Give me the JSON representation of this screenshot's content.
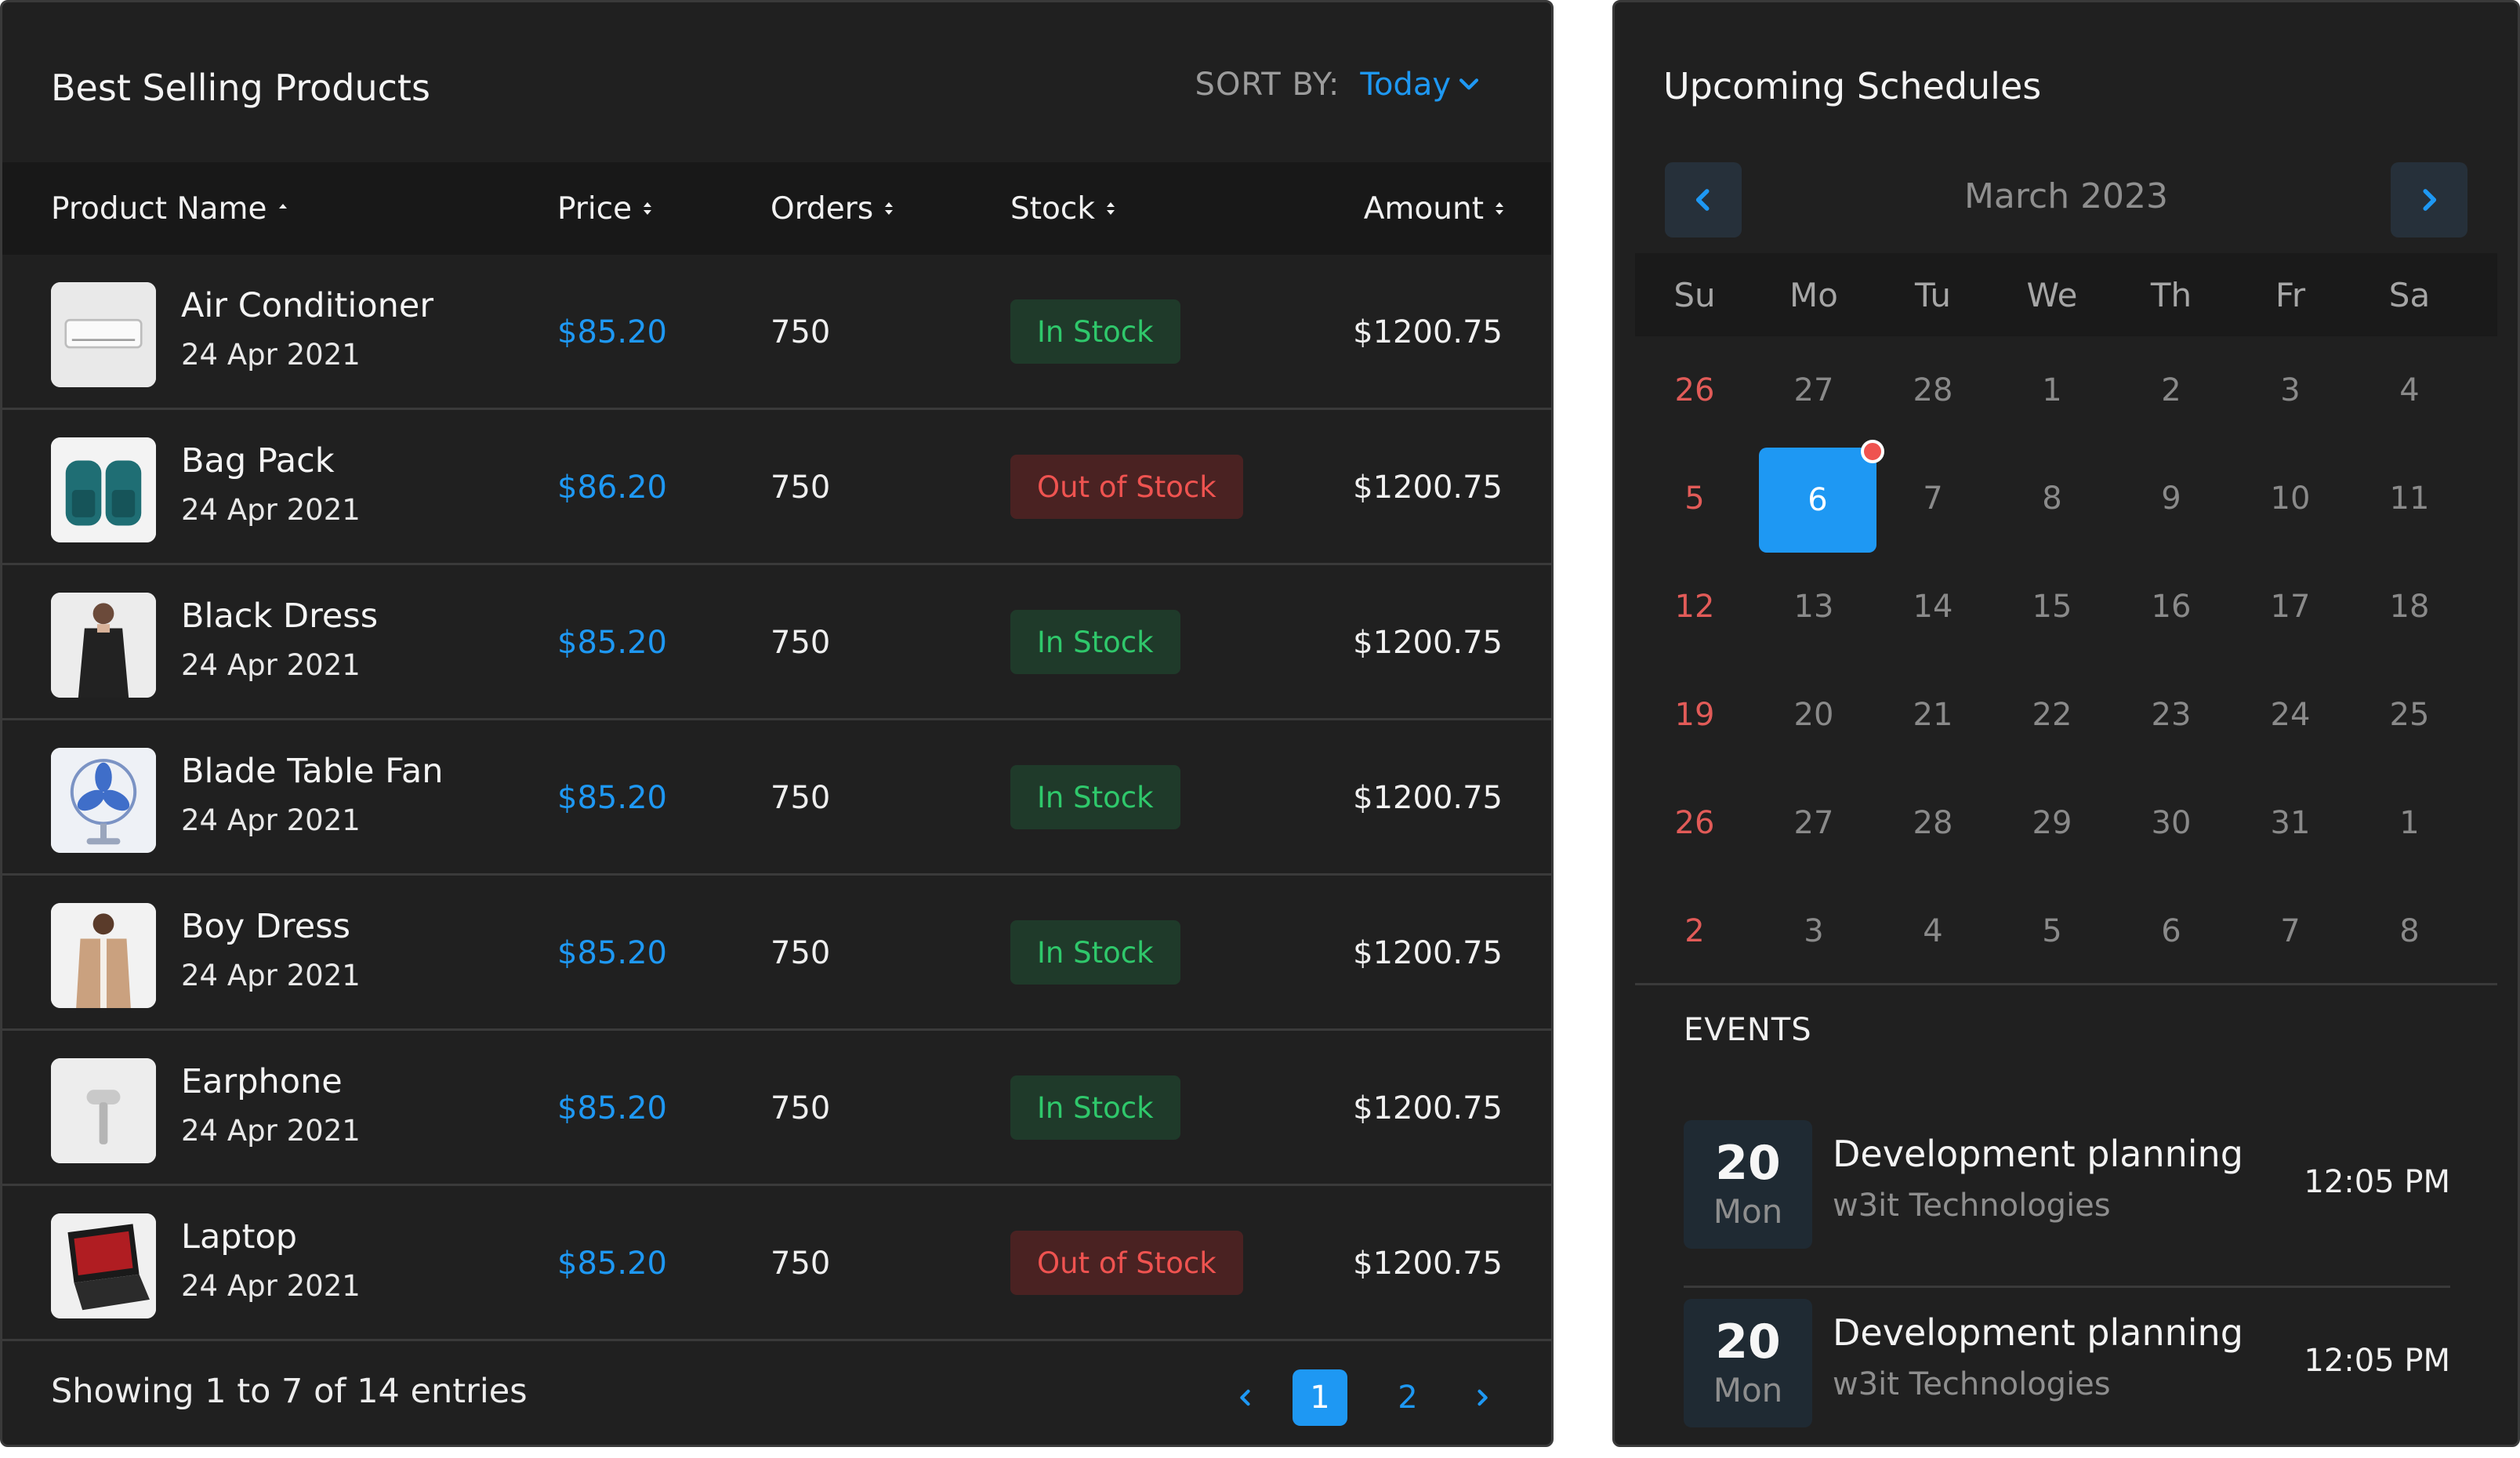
{
  "products": {
    "title": "Best Selling Products",
    "sort_label": "SORT BY:",
    "sort_value": "Today",
    "columns": {
      "name": "Product Name",
      "price": "Price",
      "orders": "Orders",
      "stock": "Stock",
      "amount": "Amount"
    },
    "rows": [
      {
        "name": "Air Conditioner",
        "date": "24 Apr 2021",
        "price": "$85.20",
        "orders": "750",
        "stock": "In Stock",
        "stock_status": "in",
        "amount": "$1200.75",
        "thumb_icon": "air-conditioner-icon"
      },
      {
        "name": "Bag Pack",
        "date": "24 Apr 2021",
        "price": "$86.20",
        "orders": "750",
        "stock": "Out of Stock",
        "stock_status": "out",
        "amount": "$1200.75",
        "thumb_icon": "backpack-icon"
      },
      {
        "name": "Black Dress",
        "date": "24 Apr 2021",
        "price": "$85.20",
        "orders": "750",
        "stock": "In Stock",
        "stock_status": "in",
        "amount": "$1200.75",
        "thumb_icon": "dress-icon"
      },
      {
        "name": "Blade Table Fan",
        "date": "24 Apr 2021",
        "price": "$85.20",
        "orders": "750",
        "stock": "In Stock",
        "stock_status": "in",
        "amount": "$1200.75",
        "thumb_icon": "fan-icon"
      },
      {
        "name": "Boy Dress",
        "date": "24 Apr 2021",
        "price": "$85.20",
        "orders": "750",
        "stock": "In Stock",
        "stock_status": "in",
        "amount": "$1200.75",
        "thumb_icon": "jacket-icon"
      },
      {
        "name": "Earphone",
        "date": "24 Apr 2021",
        "price": "$85.20",
        "orders": "750",
        "stock": "In Stock",
        "stock_status": "in",
        "amount": "$1200.75",
        "thumb_icon": "hairdryer-icon"
      },
      {
        "name": "Laptop",
        "date": "24 Apr 2021",
        "price": "$85.20",
        "orders": "750",
        "stock": "Out of Stock",
        "stock_status": "out",
        "amount": "$1200.75",
        "thumb_icon": "laptop-icon"
      }
    ],
    "footer_text": "Showing 1 to 7 of 14 entries",
    "pages": [
      "1",
      "2"
    ],
    "current_page": "1"
  },
  "schedule": {
    "title": "Upcoming Schedules",
    "month": "March 2023",
    "weekdays": [
      "Su",
      "Mo",
      "Tu",
      "We",
      "Th",
      "Fr",
      "Sa"
    ],
    "weeks": [
      [
        "26",
        "27",
        "28",
        "1",
        "2",
        "3",
        "4"
      ],
      [
        "5",
        "6",
        "7",
        "8",
        "9",
        "10",
        "11"
      ],
      [
        "12",
        "13",
        "14",
        "15",
        "16",
        "17",
        "18"
      ],
      [
        "19",
        "20",
        "21",
        "22",
        "23",
        "24",
        "25"
      ],
      [
        "26",
        "27",
        "28",
        "29",
        "30",
        "31",
        "1"
      ],
      [
        "2",
        "3",
        "4",
        "5",
        "6",
        "7",
        "8"
      ]
    ],
    "selected_day": "6",
    "events_label": "EVENTS",
    "events": [
      {
        "day": "20",
        "weekday": "Mon",
        "title": "Development planning",
        "org": "w3it Technologies",
        "time": "12:05 PM"
      },
      {
        "day": "20",
        "weekday": "Mon",
        "title": "Development planning",
        "org": "w3it Technologies",
        "time": "12:05 PM"
      }
    ]
  },
  "colors": {
    "panel_bg": "#202020",
    "accent": "#1e98f3",
    "in_stock": "#2fc86b",
    "out_of_stock": "#ef5350",
    "sunday": "#e25b58"
  }
}
